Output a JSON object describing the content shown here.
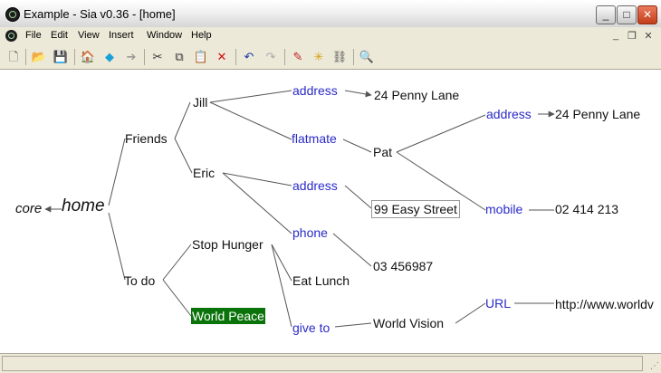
{
  "window": {
    "title": "Example - Sia v0.36 - [home]",
    "controls": {
      "minimize": "_",
      "maximize": "□",
      "close": "✕"
    }
  },
  "menubar": {
    "items": [
      "File",
      "Edit",
      "View",
      "Insert",
      "Window",
      "Help"
    ],
    "mdi": {
      "minimize": "_",
      "restore": "❐",
      "close": "✕"
    }
  },
  "toolbar": {
    "buttons": [
      {
        "name": "new-file-icon",
        "glyph": "🗋"
      },
      {
        "name": "open-folder-icon",
        "glyph": "📂"
      },
      {
        "name": "save-icon",
        "glyph": "💾"
      },
      {
        "name": "home-icon",
        "glyph": "🏠"
      },
      {
        "name": "back-icon",
        "glyph": "◆"
      },
      {
        "name": "forward-icon",
        "glyph": "➔"
      },
      {
        "name": "cut-icon",
        "glyph": "✂"
      },
      {
        "name": "copy-icon",
        "glyph": "⧉"
      },
      {
        "name": "paste-icon",
        "glyph": "📋"
      },
      {
        "name": "delete-icon",
        "glyph": "✕"
      },
      {
        "name": "undo-icon",
        "glyph": "↶"
      },
      {
        "name": "redo-icon",
        "glyph": "↷"
      },
      {
        "name": "edit-pencil-icon",
        "glyph": "✎"
      },
      {
        "name": "new-node-icon",
        "glyph": "✳"
      },
      {
        "name": "link-icon",
        "glyph": "⛓"
      },
      {
        "name": "find-binoculars-icon",
        "glyph": "🔍"
      }
    ]
  },
  "graph": {
    "nodes": {
      "core": "core",
      "home": "home",
      "friends": "Friends",
      "todo": "To do",
      "jill": "Jill",
      "eric": "Eric",
      "stop_hunger": "Stop Hunger",
      "world_peace": "World Peace",
      "jill_address": "address",
      "flatmate": "flatmate",
      "penny_lane_1": "24 Penny Lane",
      "pat": "Pat",
      "pat_address": "address",
      "penny_lane_2": "24 Penny Lane",
      "mobile": "mobile",
      "mobile_number": "02 414 213",
      "eric_address": "address",
      "easy_street": "99 Easy Street",
      "phone": "phone",
      "phone_number": "03 456987",
      "eat_lunch": "Eat Lunch",
      "give_to": "give to",
      "world_vision": "World Vision",
      "url": "URL",
      "url_value": "http://www.worldv"
    },
    "colors": {
      "relation": "#2a2ac8",
      "node": "#111111",
      "selected_bg": "#0a730a",
      "edge": "#555555"
    }
  }
}
